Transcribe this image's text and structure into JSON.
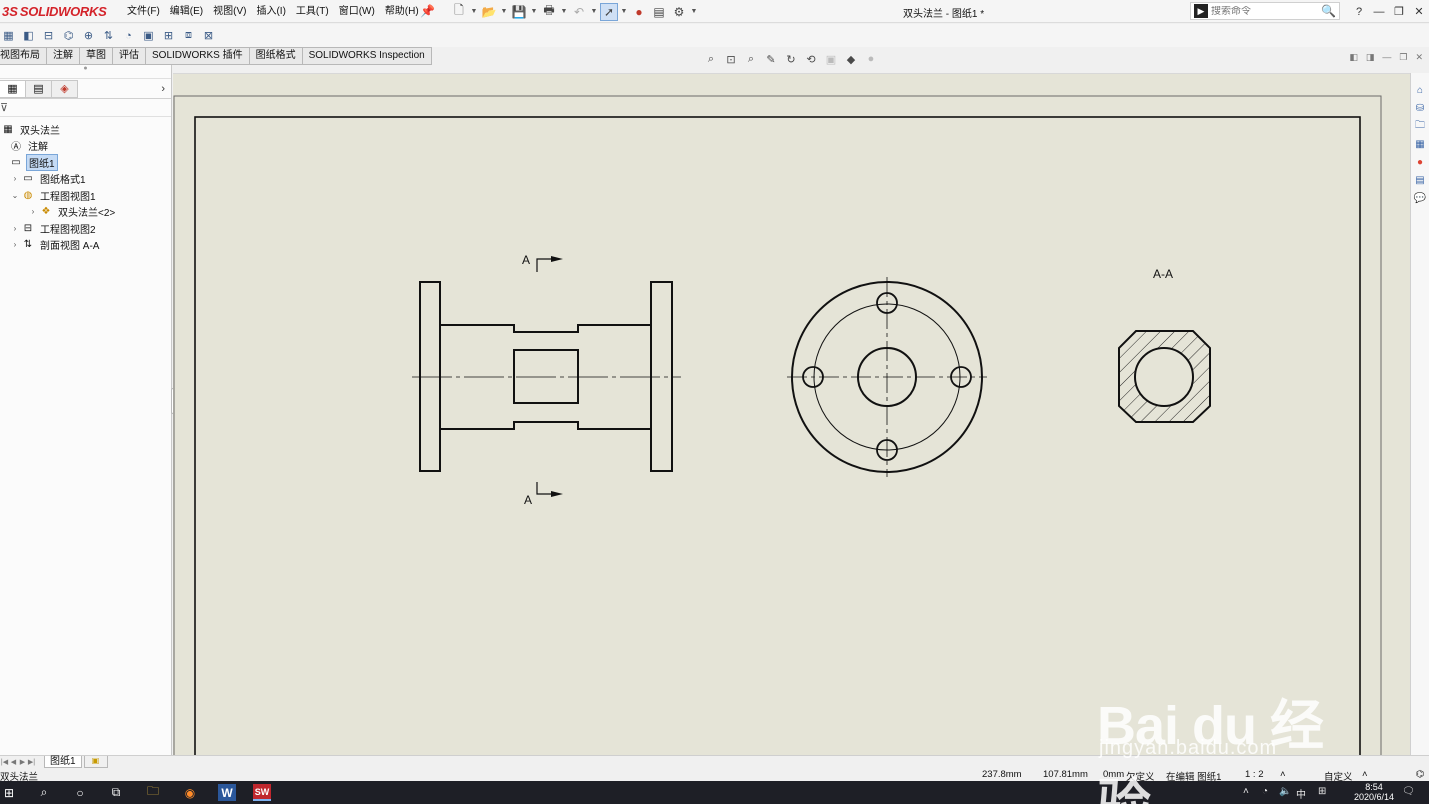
{
  "app": {
    "logo_ds": "3S",
    "logo_name": "SOLIDWORKS",
    "document_title": "双头法兰 - 图纸1 *"
  },
  "menu": [
    "文件(F)",
    "编辑(E)",
    "视图(V)",
    "插入(I)",
    "工具(T)",
    "窗口(W)",
    "帮助(H)"
  ],
  "search": {
    "placeholder": "搜索命令"
  },
  "tabs": [
    "视图布局",
    "注解",
    "草图",
    "评估",
    "SOLIDWORKS 插件",
    "图纸格式",
    "SOLIDWORKS Inspection"
  ],
  "tree": {
    "root": "双头法兰",
    "annotations": "注解",
    "sheet": "图纸1",
    "sheet_format": "图纸格式1",
    "view1": "工程图视图1",
    "part_ref": "双头法兰<2>",
    "view2": "工程图视图2",
    "section_view": "剖面视图 A-A"
  },
  "drawing": {
    "section_label_top": "A",
    "section_label_bottom": "A",
    "section_title": "A-A"
  },
  "sheet_tab": "图纸1",
  "status": {
    "part_name": "双头法兰",
    "x": "237.8mm",
    "y": "107.81mm",
    "z": "0mm",
    "definition": "欠定义",
    "editing": "在编辑 图纸1",
    "scale": "1 : 2",
    "units": "自定义"
  },
  "taskbar": {
    "time": "8:54",
    "date": "2020/6/14",
    "ime": "中"
  },
  "watermark": {
    "logo": "Bai du 经验",
    "url": "jingyan.baidu.com"
  },
  "colors": {
    "brand": "#d4232a",
    "sheet_background": "#e5e4d7",
    "selection": "#c5dbf5"
  }
}
